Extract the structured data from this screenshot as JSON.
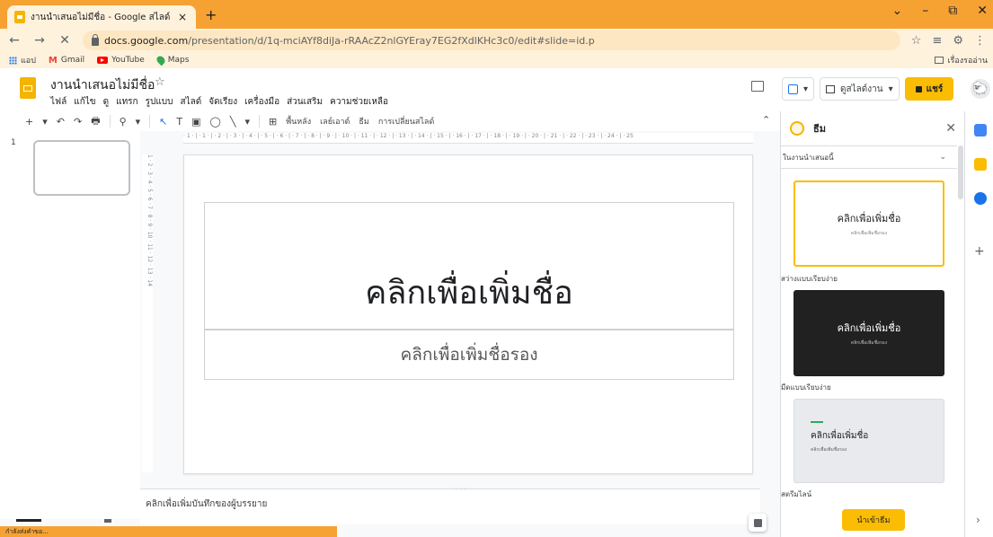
{
  "browser": {
    "tab_title": "งานนำเสนอไม่มีชื่อ - Google สไลด์",
    "tab_close": "×",
    "new_tab": "+",
    "window_controls": [
      "⌄",
      "–",
      "⧉",
      "✕"
    ],
    "url_host": "docs.google.com",
    "url_path": "/presentation/d/1q-mciAYf8diJa-rRAAcZ2nlGYEray7EG2fXdlKHc3c0/edit#slide=id.p",
    "nav": {
      "back": "←",
      "forward": "→",
      "reload": "✕"
    },
    "right_icons": [
      "☆",
      "≡",
      "⚙",
      "⋮"
    ],
    "bookmarks": [
      "แอป",
      "Gmail",
      "YouTube",
      "Maps"
    ],
    "bookmark_gmail_glyph": "M",
    "reading_list": "เรื่องรออ่าน"
  },
  "app": {
    "doc_title": "งานนำเสนอไม่มีชื่อ",
    "star": "☆",
    "menu": [
      "ไฟล์",
      "แก้ไข",
      "ดู",
      "แทรก",
      "รูปแบบ",
      "สไลด์",
      "จัดเรียง",
      "เครื่องมือ",
      "ส่วนเสริม",
      "ความช่วยเหลือ"
    ],
    "present_label": "ดูสไลด์งาน",
    "share_label": "แชร์",
    "dropdown_glyph": "▾",
    "avatar_glyph": "🐑"
  },
  "toolbar": {
    "icons": [
      "+",
      "▾",
      "↶",
      "↷",
      "🖶",
      "⚲",
      "▾",
      "↖",
      "T",
      "▣",
      "◯",
      "╲",
      "▾",
      "⊞"
    ],
    "background": "พื้นหลัง",
    "layout": "เลย์เอาต์",
    "theme": "ธีม",
    "transition": "การเปลี่ยนสไลด์",
    "collapse": "⌃"
  },
  "ruler": {
    "h_marks": "· 1 · | · 1 · | · 2 · | · 3 · | · 4 · | · 5 · | · 6 · | · 7 · | · 8 · | · 9 · | · 10 · | · 11 · | · 12 · | · 13 · | · 14 · | · 15 · | · 16 · | · 17 · | · 18 · | · 19 · | · 20 · | · 21 · | · 22 · | · 23 · | · 24 · | · 25",
    "v_marks": "1 · 2 · 3 · 4 · 5 · 6 · 7 · 8 · 9 · 10 · 11 · 12 · 13 · 14"
  },
  "filmstrip": {
    "slide_number": "1"
  },
  "slide": {
    "title_placeholder": "คลิกเพื่อเพิ่มชื่อ",
    "subtitle_placeholder": "คลิกเพื่อเพิ่มชื่อรอง"
  },
  "notes": {
    "placeholder": "คลิกเพื่อเพิ่มบันทึกของผู้บรรยาย",
    "drag_handle": "· · ·"
  },
  "theme_panel": {
    "title": "ธีม",
    "close": "✕",
    "source_label": "ในงานนำเสนอนี้",
    "chevron": "⌄",
    "themes": [
      {
        "name": "สว่างแบบเรียบง่าย",
        "preview_title": "คลิกเพื่อเพิ่มชื่อ",
        "preview_sub": "คลิกเพื่อเพิ่มชื่อรอง"
      },
      {
        "name": "มืดแบบเรียบง่าย",
        "preview_title": "คลิกเพื่อเพิ่มชื่อ",
        "preview_sub": "คลิกเพื่อเพิ่มชื่อรอง"
      },
      {
        "name": "สตรีมไลน์",
        "preview_title": "คลิกเพื่อเพิ่มชื่อ",
        "preview_sub": "คลิกเพื่อเพิ่มชื่อรอง"
      }
    ],
    "import_label": "นำเข้าธีม"
  },
  "sidepanel": {
    "plus": "+",
    "expand": "›"
  },
  "status": {
    "text": "กำลังส่งคำขอ..."
  },
  "colors": {
    "browser_accent": "#f6a233",
    "slides_yellow": "#fbbc04",
    "selected_border": "#fbbc04"
  }
}
